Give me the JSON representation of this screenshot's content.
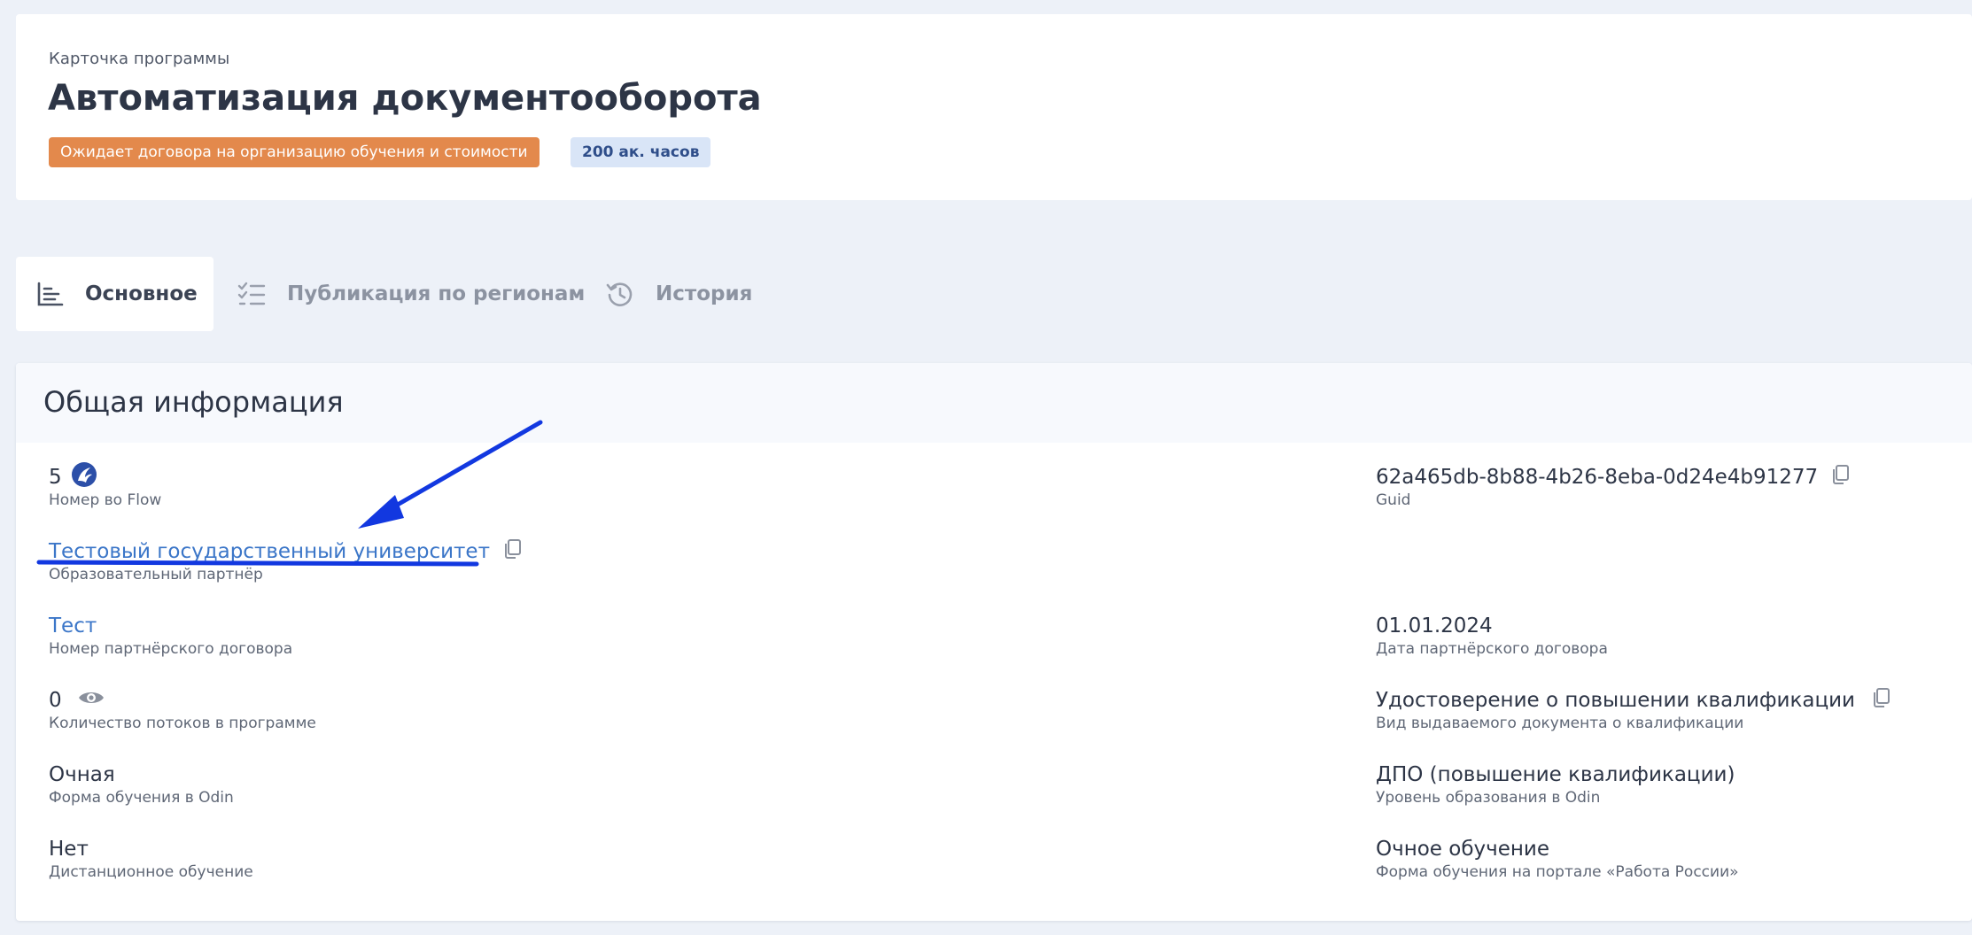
{
  "header": {
    "subtitle": "Карточка программы",
    "title": "Автоматизация документооборота",
    "status_badge": "Ожидает договора на организацию обучения и стоимости",
    "hours_badge": "200 ак. часов"
  },
  "tabs": [
    {
      "label": "Основное",
      "icon": "chart-bars-icon",
      "active": true
    },
    {
      "label": "Публикация по регионам",
      "icon": "checklist-icon",
      "active": false
    },
    {
      "label": "История",
      "icon": "history-icon",
      "active": false
    }
  ],
  "general": {
    "title": "Общая информация",
    "left": [
      {
        "value": "5",
        "label": "Номер во Flow",
        "icon": "flow-logo-icon"
      },
      {
        "value": "Тестовый государственный университет",
        "label": "Образовательный партнёр",
        "icon": "copy-icon"
      },
      {
        "value": "Тест",
        "label": "Номер партнёрского договора"
      },
      {
        "value": "0",
        "label": "Количество потоков в программе",
        "icon": "eye-icon"
      },
      {
        "value": "Очная",
        "label": "Форма обучения в Odin"
      },
      {
        "value": "Нет",
        "label": "Дистанционное обучение"
      }
    ],
    "right": [
      {
        "value": "62a465db-8b88-4b26-8eba-0d24e4b91277",
        "label": "Guid",
        "icon": "copy-icon"
      },
      {
        "value": "01.01.2024",
        "label": "Дата партнёрского договора"
      },
      {
        "value": "Удостоверение о повышении квалификации",
        "label": "Вид выдаваемого документа о квалификации",
        "icon": "copy-icon"
      },
      {
        "value": "ДПО (повышение квалификации)",
        "label": "Уровень образования в Odin"
      },
      {
        "value": "Очное обучение",
        "label": "Форма обучения на портале «Работа России»"
      }
    ]
  },
  "colors": {
    "status_badge_bg": "#e3894c",
    "hours_badge_bg": "#d9e5f7",
    "link": "#3b76c8",
    "annotation": "#1238e0"
  }
}
